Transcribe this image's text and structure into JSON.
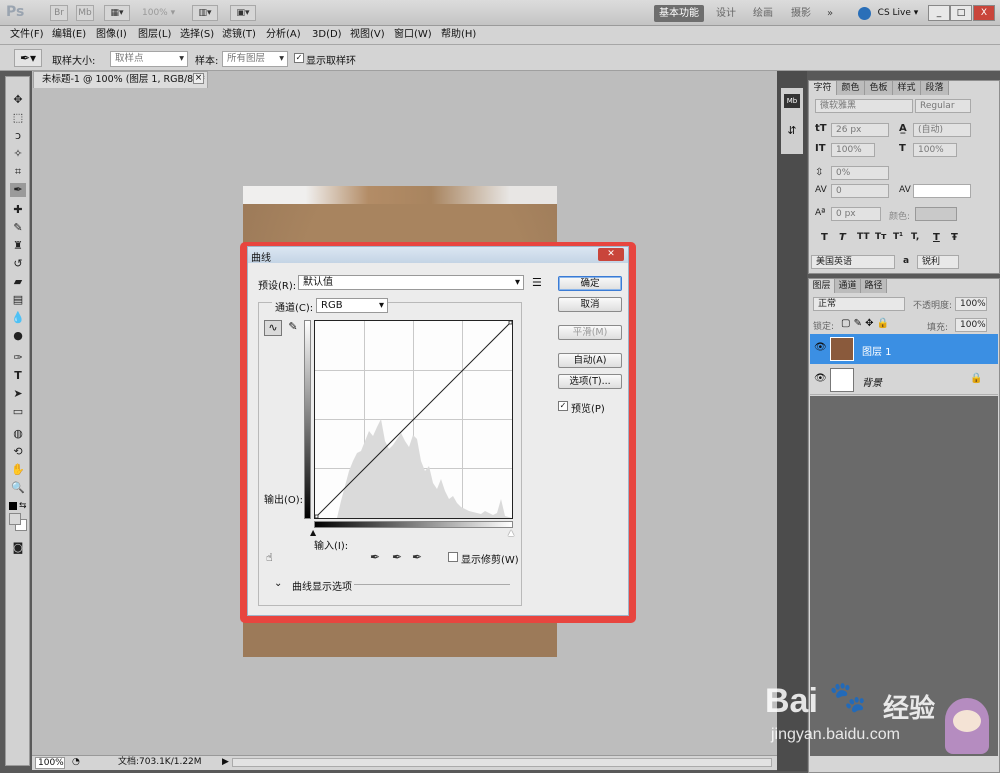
{
  "app": {
    "logo": "Ps",
    "zoom": "100%",
    "workspaces": [
      "基本功能",
      "设计",
      "绘画",
      "摄影"
    ],
    "more": "»",
    "cslive": "CS Live",
    "window_buttons": [
      "_",
      "□",
      "X"
    ]
  },
  "menubar": [
    "文件(F)",
    "编辑(E)",
    "图像(I)",
    "图层(L)",
    "选择(S)",
    "滤镜(T)",
    "分析(A)",
    "3D(D)",
    "视图(V)",
    "窗口(W)",
    "帮助(H)"
  ],
  "options": {
    "sample_size_label": "取样大小:",
    "sample_size_value": "取样点",
    "sample_label": "样本:",
    "sample_value": "所有图层",
    "show_ring_label": "显示取样环"
  },
  "document": {
    "tab_title": "未标题-1 @ 100% (图层 1, RGB/8) *",
    "tab_close": "×",
    "zoom": "100%",
    "doc_info": "文档:703.1K/1.22M"
  },
  "character_panel": {
    "tabs": [
      "字符",
      "颜色",
      "色板",
      "样式",
      "段落"
    ],
    "font_family": "微软雅黑",
    "font_style": "Regular",
    "font_size": "26 px",
    "leading": "(自动)",
    "vertical_scale": "100%",
    "horizontal_scale": "100%",
    "baseline_pct": "0%",
    "kerning": "0",
    "baseline_shift": "0 px",
    "color_label": "颜色:",
    "type_styles": [
      "T",
      "T",
      "TT",
      "Tт",
      "T¹",
      "T,",
      "T",
      "Ŧ"
    ],
    "language": "美国英语",
    "aa_label": "a",
    "aa_value": "锐利"
  },
  "layers_panel": {
    "tabs": [
      "图层",
      "通道",
      "路径"
    ],
    "blend_mode": "正常",
    "opacity_label": "不透明度:",
    "opacity": "100%",
    "lock_label": "锁定:",
    "fill_label": "填充:",
    "fill": "100%",
    "layers": [
      {
        "name": "图层 1",
        "selected": true
      },
      {
        "name": "背景",
        "selected": false
      }
    ]
  },
  "curves_dialog": {
    "title": "曲线",
    "preset_label": "预设(R):",
    "preset_value": "默认值",
    "channel_label": "通道(C):",
    "channel_value": "RGB",
    "output_label": "输出(O):",
    "input_label": "输入(I):",
    "show_clipping_label": "显示修剪(W)",
    "display_options_label": "曲线显示选项",
    "buttons": {
      "ok": "确定",
      "cancel": "取消",
      "smooth": "平滑(M)",
      "auto": "自动(A)",
      "options": "选项(T)..."
    },
    "preview_label": "预览(P)",
    "preview_checked": true
  },
  "watermark": {
    "brand": "Bai",
    "brand_cn": "经验",
    "url": "jingyan.baidu.com"
  }
}
